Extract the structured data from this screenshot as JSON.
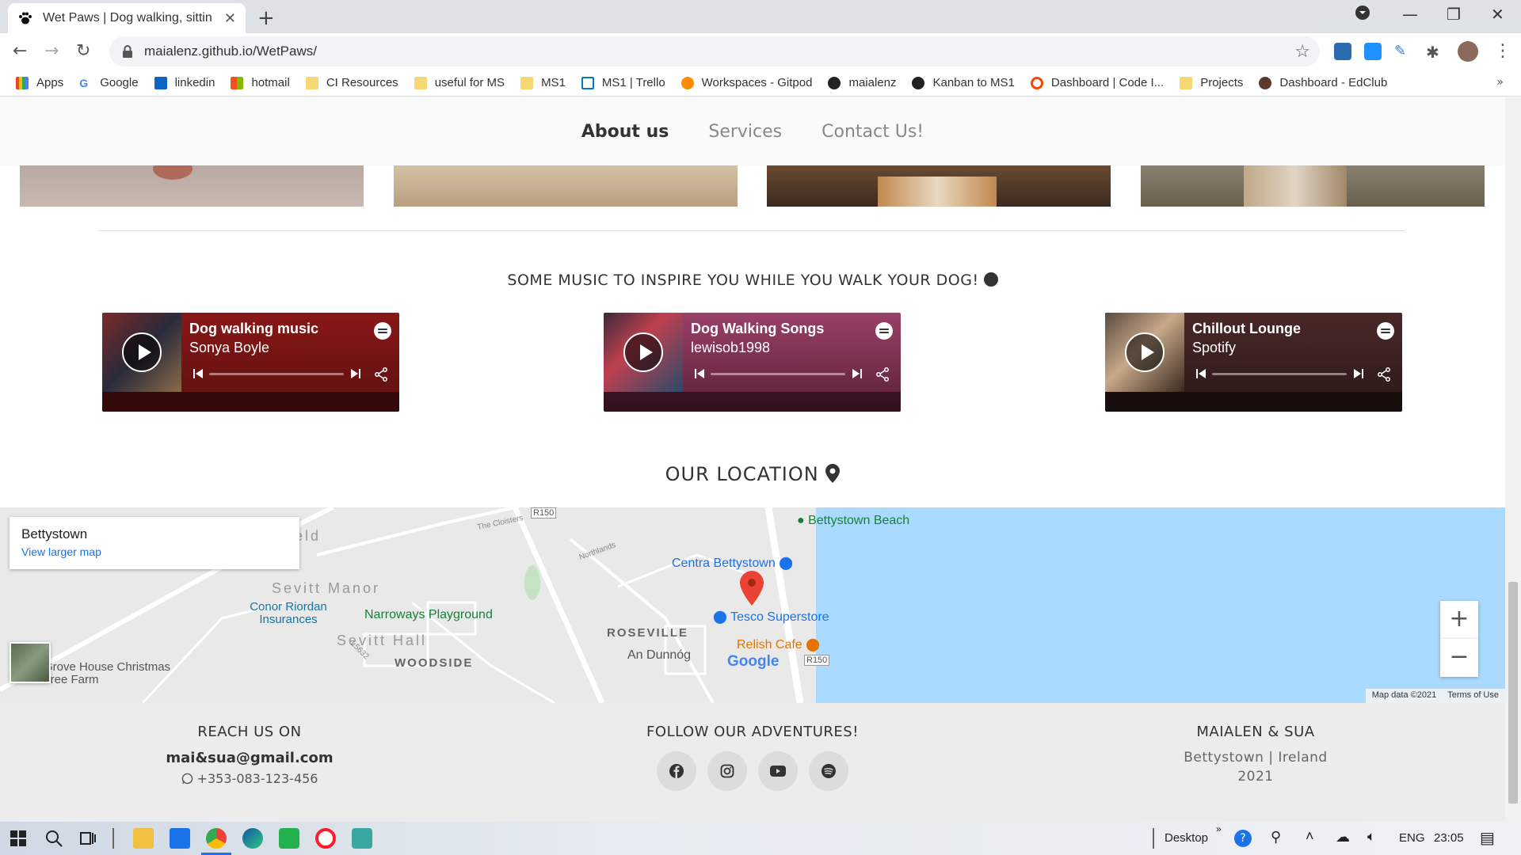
{
  "browser": {
    "tab_title": "Wet Paws | Dog walking, sitting a",
    "new_tab": "+",
    "url": "maialenz.github.io/WetPaws/",
    "bookmarks": [
      "Apps",
      "Google",
      "linkedin",
      "hotmail",
      "CI Resources",
      "useful for MS",
      "MS1",
      "MS1 | Trello",
      "Workspaces - Gitpod",
      "maialenz",
      "Kanban to MS1",
      "Dashboard | Code I...",
      "Projects",
      "Dashboard - EdClub"
    ],
    "bookmarks_more": "»"
  },
  "nav": {
    "items": [
      "About us",
      "Services",
      "Contact Us!"
    ]
  },
  "music": {
    "title": "SOME MUSIC TO INSPIRE YOU WHILE YOU WALK YOUR DOG!",
    "players": [
      {
        "title": "Dog walking music",
        "by": "Sonya Boyle",
        "color": "#8a1717"
      },
      {
        "title": "Dog Walking Songs",
        "by": "lewisob1998",
        "color": "#8a3a5e"
      },
      {
        "title": "Chillout Lounge",
        "by": "Spotify",
        "color": "#3a2020"
      }
    ]
  },
  "location": {
    "title": "OUR LOCATION",
    "map": {
      "place": "Bettystown",
      "larger_map": "View larger map",
      "labels": {
        "beach": "Bettystown Beach",
        "centra": "Centra Bettystown",
        "tesco": "Tesco Superstore",
        "relish": "Relish Cafe",
        "conor": "Conor Riordan Insurances",
        "narroways": "Narroways Playground",
        "sevitt_manor": "Sevitt Manor",
        "sevitt_hall": "Sevitt Hall",
        "roseville": "ROSEVILLE",
        "woodside": "WOODSIDE",
        "dunnog": "An Dunnóg",
        "grove": "Grove House Christmas Tree Farm",
        "r150a": "R150",
        "r150b": "R150",
        "cloisters": "The Cloisters",
        "northlands": "Northlands",
        "l5632": "L5632",
        "eld": "eld",
        "google": "Google"
      },
      "zoom_in": "+",
      "zoom_out": "−",
      "map_data": "Map data ©2021",
      "terms": "Terms of Use"
    }
  },
  "footer": {
    "reach_title": "REACH US ON",
    "email": "mai&sua@gmail.com",
    "phone": "+353-083-123-456",
    "follow_title": "FOLLOW OUR ADVENTURES!",
    "brand_title": "MAIALEN & SUA",
    "brand_place": "Bettystown | Ireland",
    "brand_year": "2021"
  },
  "taskbar": {
    "desktop": "Desktop",
    "lang": "ENG",
    "time": "23:05"
  }
}
